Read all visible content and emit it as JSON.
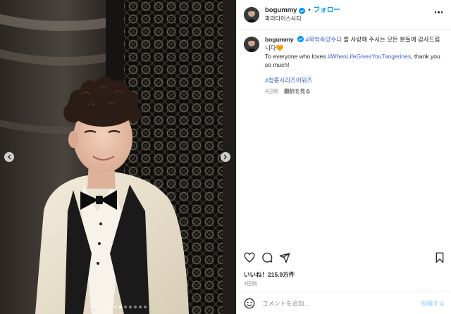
{
  "post": {
    "username": "bogummy",
    "follow_label": "フォロー",
    "separator": "•",
    "location": "파라다이스시티",
    "caption": {
      "hashtag1": "#목싹속았수다",
      "line1_rest": " 를 사랑해 주시는 모든 분들께 감사드립니다",
      "heart": "🧡",
      "line2_prefix": "To everyone who loves ",
      "hashtag2": "#WhenLifeGivesYouTangerines",
      "line2_suffix": ", thank you so much!",
      "hashtag3": "#청룡시리즈어워즈"
    },
    "comment_time": "4日前",
    "translate_label": "翻訳を見る",
    "likes": "いいね！215.9万件",
    "date": "4日前",
    "composer_placeholder": "コメントを追加...",
    "post_button": "投稿する"
  },
  "carousel": {
    "total": 12,
    "active_index": 6
  },
  "icons": [
    "verified-icon",
    "more-icon",
    "heart-icon",
    "comment-icon",
    "share-icon",
    "bookmark-icon",
    "emoji-icon",
    "chevron-left-icon",
    "chevron-right-icon"
  ],
  "colors": {
    "link": "#0095f6",
    "hashtag": "#00376b",
    "verified": "#0095f6",
    "muted": "#8e8e8e"
  }
}
